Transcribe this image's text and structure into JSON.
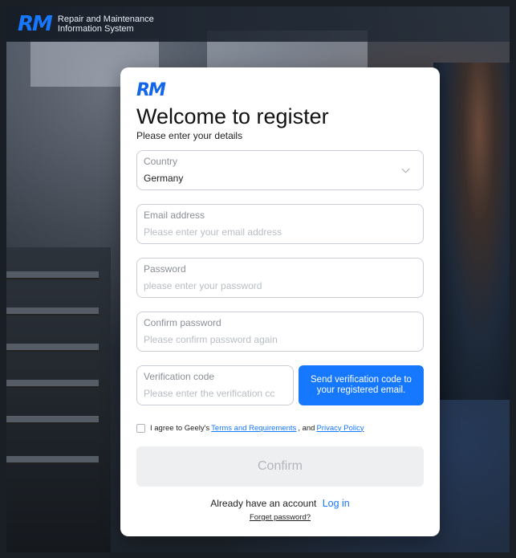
{
  "header": {
    "logo": "RM",
    "system_name_line1": "Repair and Maintenance",
    "system_name_line2": "Information System"
  },
  "card": {
    "logo": "RM",
    "title": "Welcome to register",
    "subtitle": "Please enter your details"
  },
  "form": {
    "country": {
      "label": "Country",
      "value": "Germany"
    },
    "email": {
      "label": "Email address",
      "placeholder": "Please enter your email address"
    },
    "password": {
      "label": "Password",
      "placeholder": "please enter your password"
    },
    "confirm_password": {
      "label": "Confirm password",
      "placeholder": "Please confirm password again"
    },
    "verification": {
      "label": "Verification code",
      "placeholder": "Please enter the verification cc"
    },
    "send_code_button": "Send verification code to your registered email.",
    "agreement": {
      "checked": false,
      "prefix": "I agree to Geely's",
      "terms_link": "Terms and Requirements",
      "separator": ", and",
      "privacy_link": "Privacy Policy"
    },
    "confirm_button": "Confirm"
  },
  "footer": {
    "account_prompt": "Already have an account",
    "login_link": "Log in",
    "forgot_link": "Forget password?"
  },
  "colors": {
    "accent": "#1677ff",
    "disabled_button_bg": "#eeeff1",
    "disabled_button_text": "#b2b6bc"
  }
}
